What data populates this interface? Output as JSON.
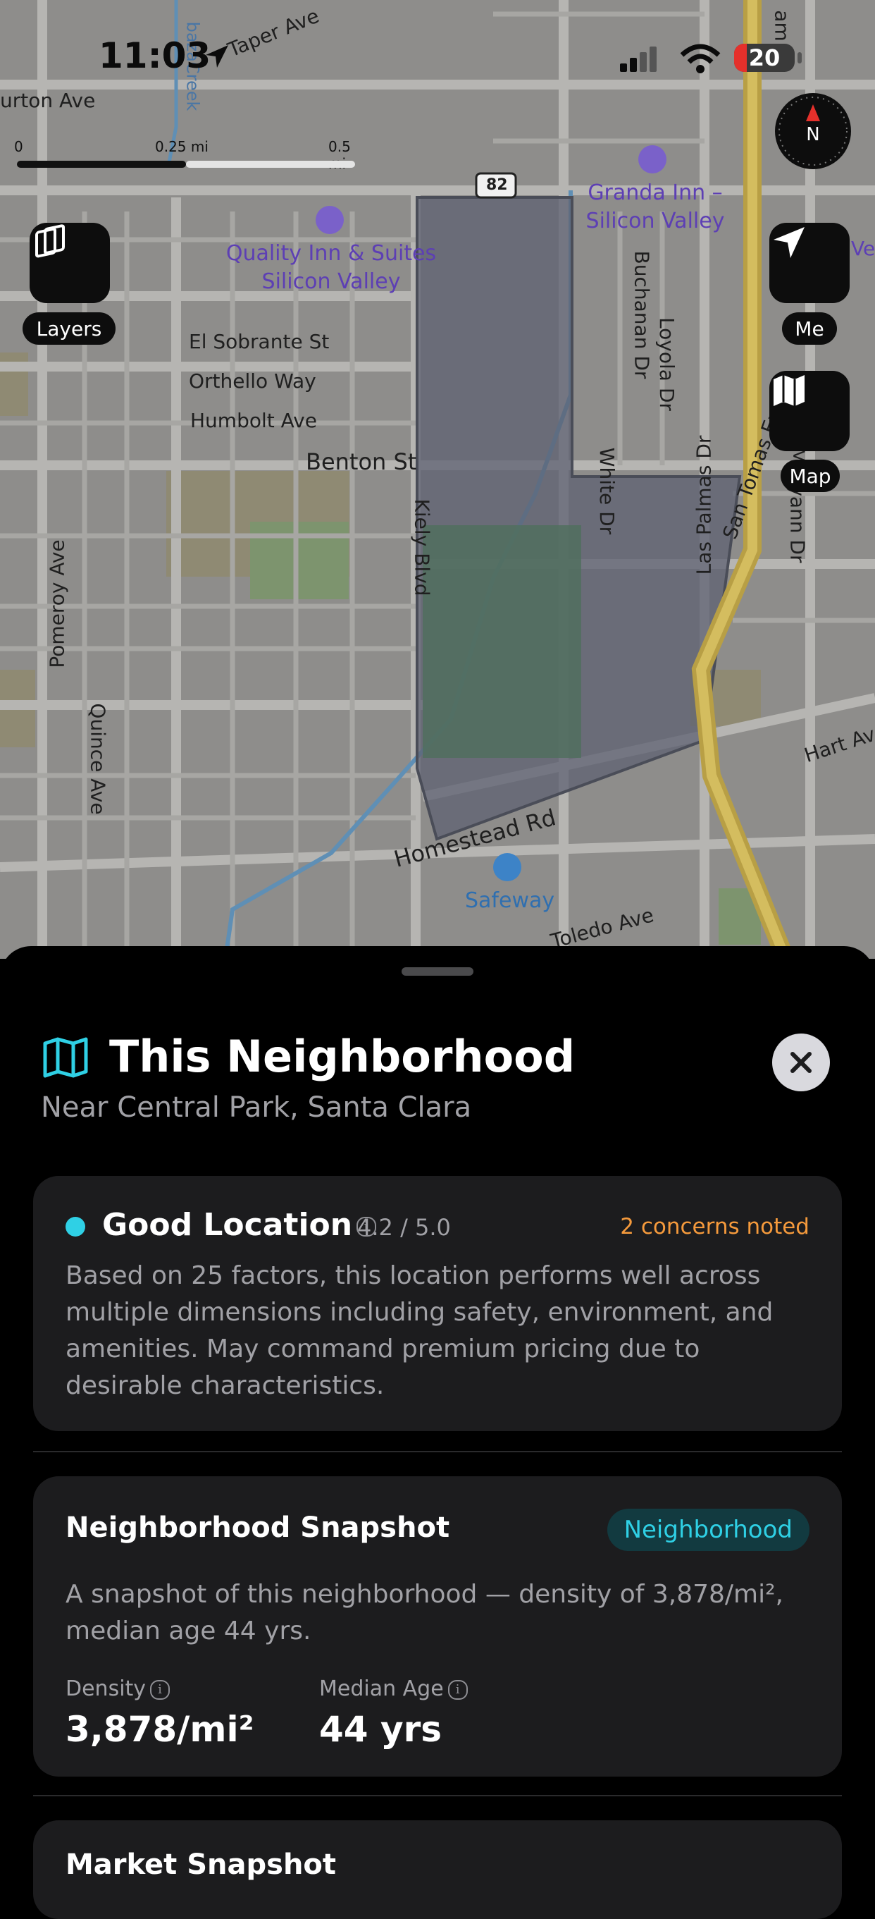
{
  "status_bar": {
    "time": "11:03",
    "battery": "20"
  },
  "map": {
    "scale": {
      "labels": [
        "0",
        "0.25 mi",
        "0.5 mi"
      ]
    },
    "route_shield": "82",
    "streets": [
      "Taper Ave",
      "urton Ave",
      "bazaCreek",
      "El Sobrante St",
      "Orthello Way",
      "Humbolt Ave",
      "Benton St",
      "Kiely Blvd",
      "White Dr",
      "Buchanan Dr",
      "Loyola Dr",
      "Las Palmas Dr",
      "San Tomas Expy",
      "Maryann Dr",
      "Pomeroy Ave",
      "Quince Ave",
      "Homestead Rd",
      "Toledo Ave",
      "Hart Av",
      "am",
      "Ves"
    ],
    "pois": {
      "quality_inn_line1": "Quality Inn & Suites",
      "quality_inn_line2": "Silicon Valley",
      "granda_inn_line1": "Granda Inn –",
      "granda_inn_line2": "Silicon Valley",
      "safeway": "Safeway"
    },
    "buttons": {
      "layers": "Layers",
      "me": "Me",
      "map": "Map"
    },
    "compass_label": "N"
  },
  "sheet": {
    "title": "This Neighborhood",
    "subtitle": "Near Central Park, Santa Clara",
    "icon": "map-icon",
    "rating_card": {
      "label": "Good Location",
      "score": "4.2 / 5.0",
      "concerns": "2 concerns noted",
      "description": "Based on 25 factors, this location performs well across multiple dimensions including safety, environment, and amenities. May command premium pricing due to desirable characteristics."
    },
    "snapshot_card": {
      "title": "Neighborhood Snapshot",
      "tag": "Neighborhood",
      "description": "A snapshot of this neighborhood — density of 3,878/mi², median age 44 yrs.",
      "density_label": "Density",
      "density_value": "3,878/mi²",
      "age_label": "Median Age",
      "age_value": "44 yrs"
    },
    "market_card": {
      "title": "Market Snapshot"
    }
  },
  "colors": {
    "accent_teal": "#2fd0e5",
    "concern_orange": "#f59a3c",
    "map_bg": "#8e8d8b",
    "highlight": "#5d6171"
  }
}
